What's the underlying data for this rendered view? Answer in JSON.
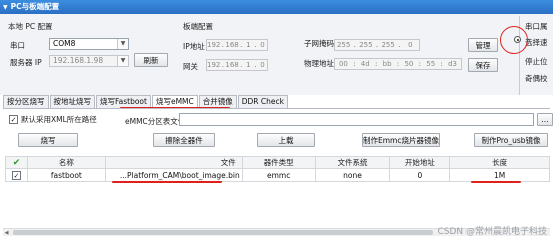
{
  "panel_title": "PC与板端配置",
  "local_pc": {
    "group_title": "本地 PC 配置",
    "port_label": "串口",
    "port_value": "COM8",
    "server_ip_label": "服务器 IP",
    "server_ip_value": "192.168.1.98",
    "refresh_label": "刷新"
  },
  "board": {
    "group_title": "板端配置",
    "ip_label": "IP地址",
    "ip": [
      "192",
      "168",
      "1",
      "0"
    ],
    "gateway_label": "网关",
    "gateway": [
      "192",
      "168",
      "1",
      "0"
    ],
    "mask_label": "子网掩码",
    "mask": [
      "255",
      "255",
      "255",
      "0"
    ],
    "mac_label": "物理地址",
    "mac": [
      "00",
      "4d",
      "bb",
      "50",
      "55",
      "d3"
    ],
    "manage_label": "管理",
    "save_label": "保存"
  },
  "right_panel": {
    "serial_label": "串口属",
    "speed_label": "选择速",
    "stop_label": "停止位",
    "parity_label": "奇偶校"
  },
  "tabs": [
    {
      "label": "按分区烧写",
      "active": false
    },
    {
      "label": "按地址烧写",
      "active": false
    },
    {
      "label": "烧写Fastboot",
      "active": false
    },
    {
      "label": "烧写eMMC",
      "active": true
    },
    {
      "label": "合并镜像",
      "active": false
    },
    {
      "label": "DDR Check",
      "active": false
    }
  ],
  "emmc": {
    "use_xml_label": "默认采用XML所在路径",
    "partition_file_label": "eMMC分区表文件",
    "partition_file_value": "",
    "browse_label": "...",
    "burn_label": "烧写",
    "erase_all_label": "擦除全器件",
    "upload_label": "上载",
    "make_emmc_label": "制作Emmc烧片器镜像",
    "make_pro_usb_label": "制作Pro_usb镜像"
  },
  "table": {
    "headers": [
      "",
      "名称",
      "文件",
      "器件类型",
      "文件系统",
      "开始地址",
      "长度"
    ],
    "rows": [
      {
        "checked": true,
        "name": "fastboot",
        "file": "...Platform_CAM\\boot_image.bin",
        "device": "emmc",
        "fs": "none",
        "start": "0",
        "length": "1M"
      }
    ]
  },
  "watermark": "CSDN @常州晨凯电子科技",
  "colors": {
    "title_bar": "#2a6fc4",
    "annotation": "#e0201a",
    "check_green": "#2e9b2e"
  }
}
